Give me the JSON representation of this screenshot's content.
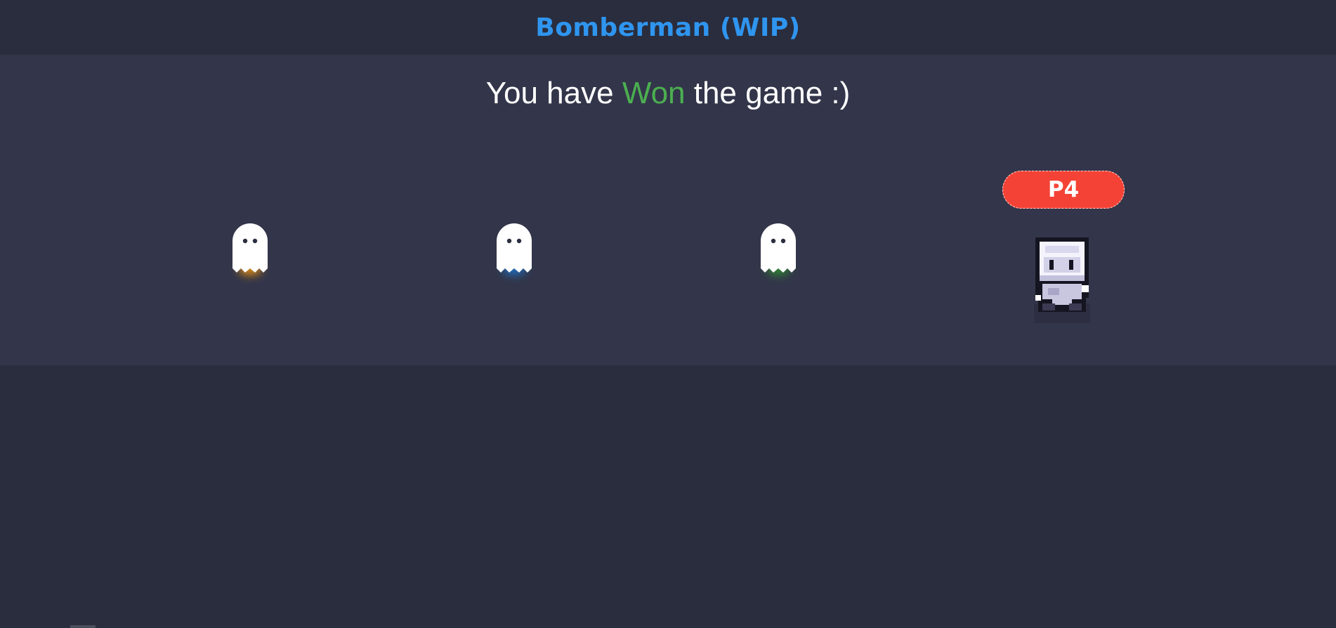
{
  "app": {
    "title": "Bomberman (WIP)",
    "title_color": "#2f95ef"
  },
  "result": {
    "prefix": "You have ",
    "outcome": "Won",
    "outcome_color": "#4caf50",
    "suffix": " the game :)"
  },
  "players": [
    {
      "slot": "p1",
      "state": "eliminated",
      "icon": "ghost-icon",
      "glow_color": "#e8900c"
    },
    {
      "slot": "p2",
      "state": "eliminated",
      "icon": "ghost-icon",
      "glow_color": "#1e6fc4"
    },
    {
      "slot": "p3",
      "state": "eliminated",
      "icon": "ghost-icon",
      "glow_color": "#2e8b2e"
    },
    {
      "slot": "p4",
      "state": "alive",
      "icon": "player-character-icon",
      "label": "P4",
      "badge_color": "#f44336"
    }
  ]
}
